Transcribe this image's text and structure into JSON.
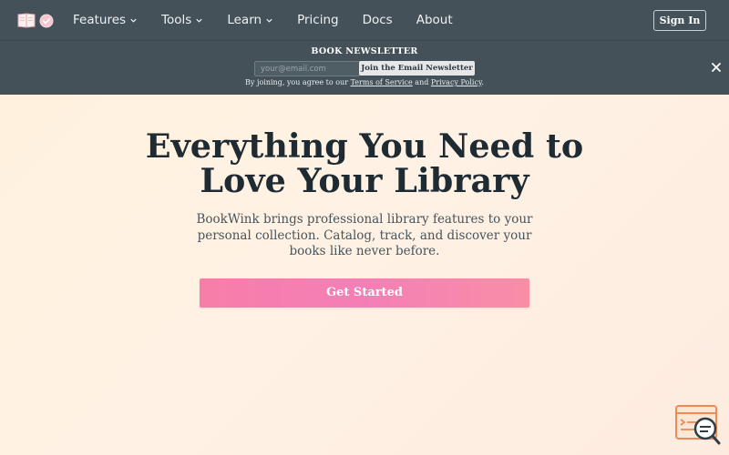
{
  "header": {
    "logo_icon": "book-heart-logo",
    "nav": [
      {
        "label": "Features",
        "dropdown": true
      },
      {
        "label": "Tools",
        "dropdown": true
      },
      {
        "label": "Learn",
        "dropdown": true
      },
      {
        "label": "Pricing",
        "dropdown": false
      },
      {
        "label": "Docs",
        "dropdown": false
      },
      {
        "label": "About",
        "dropdown": false
      }
    ],
    "sign_in": "Sign In"
  },
  "newsletter": {
    "title": "BOOK NEWSLETTER",
    "email_placeholder": "your@email.com",
    "join_label": "Join the Email Newsletter",
    "terms_prefix": "By joining, you agree to our",
    "terms_link": "Terms of Service",
    "terms_and": "and",
    "privacy_link": "Privacy Policy",
    "terms_suffix": ".",
    "close_icon": "close-icon"
  },
  "hero": {
    "title_line1": "Everything You Need to",
    "title_line2": "Love Your Library",
    "subtitle": "BookWink brings professional library features to your personal collection. Catalog, track, and discover your books like never before.",
    "cta": "Get Started"
  },
  "widget": {
    "icon": "search-chat-widget-icon"
  },
  "colors": {
    "nav_bg": "#445159",
    "hero_title": "#1f2b33",
    "cta_pink": "#f47fb6",
    "logo_pink": "#f08aa6"
  }
}
